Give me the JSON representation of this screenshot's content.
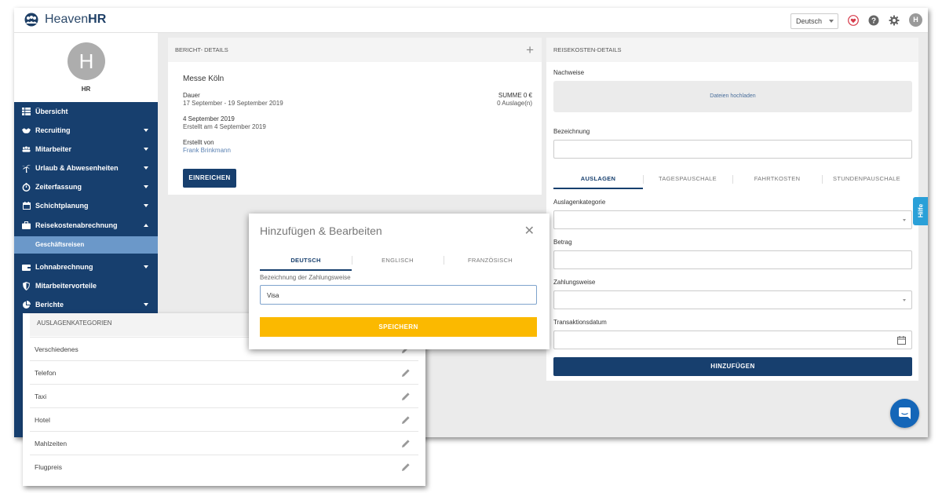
{
  "brand": {
    "name_light": "Heaven",
    "name_bold": "HR"
  },
  "topbar": {
    "language": "Deutsch",
    "avatar_initial": "H"
  },
  "user": {
    "initial": "H",
    "name": "HR"
  },
  "nav": {
    "items": [
      {
        "label": "Übersicht"
      },
      {
        "label": "Recruiting"
      },
      {
        "label": "Mitarbeiter"
      },
      {
        "label": "Urlaub & Abwesenheiten"
      },
      {
        "label": "Zeiterfassung"
      },
      {
        "label": "Schichtplanung"
      },
      {
        "label": "Reisekostenabrechnung"
      },
      {
        "label": "Lohnabrechnung"
      },
      {
        "label": "Mitarbeitervorteile"
      },
      {
        "label": "Berichte"
      }
    ],
    "sub_item": "Geschäftsreisen"
  },
  "report": {
    "header": "BERICHT- DETAILS",
    "title": "Messe Köln",
    "duration_label": "Dauer",
    "duration_value": "17 September - 19 September 2019",
    "sum_label": "SUMME 0 €",
    "expense_count": "0 Auslage(n)",
    "date": "4 September 2019",
    "created_on": "Erstellt am 4 September 2019",
    "created_by_label": "Erstellt von",
    "created_by_name": "Frank Brinkmann",
    "submit_label": "EINREICHEN"
  },
  "travel": {
    "header": "REISEKOSTEN-DETAILS",
    "receipts_label": "Nachweise",
    "upload_label": "Dateien hochladen",
    "designation_label": "Bezeichnung",
    "tabs": [
      "AUSLAGEN",
      "TAGESPAUSCHALE",
      "FAHRTKOSTEN",
      "STUNDENPAUSCHALE"
    ],
    "category_label": "Auslagenkategorie",
    "amount_label": "Betrag",
    "payment_label": "Zahlungsweise",
    "transaction_date_label": "Transaktionsdatum",
    "add_label": "HINZUFÜGEN"
  },
  "help": {
    "label": "Hilfe"
  },
  "modal": {
    "title": "Hinzufügen & Bearbeiten",
    "tabs": [
      "DEUTSCH",
      "ENGLISCH",
      "FRANZÖSISCH"
    ],
    "field_label": "Bezeichnung der Zahlungsweise",
    "field_value": "Visa",
    "save_label": "SPEICHERN"
  },
  "categories": {
    "header": "AUSLAGENKATEGORIEN",
    "items": [
      "Verschiedenes",
      "Telefon",
      "Taxi",
      "Hotel",
      "Mahlzeiten",
      "Flugpreis"
    ]
  },
  "colors": {
    "navy": "#173f6e",
    "sidebar_active": "#6b98c9",
    "accent_yellow": "#fbb900",
    "help_blue": "#2aa0d8",
    "chat_blue": "#1466b8"
  },
  "icons": [
    "people-logo-icon",
    "heart-icon",
    "help-circle-icon",
    "gear-icon",
    "dashboard-icon",
    "handshake-icon",
    "team-icon",
    "palm-tree-icon",
    "stopwatch-icon",
    "calendar-icon",
    "suitcase-icon",
    "wallet-icon",
    "shield-icon",
    "pie-chart-icon",
    "calendar-icon",
    "pencil-icon",
    "close-icon",
    "chat-icon"
  ]
}
